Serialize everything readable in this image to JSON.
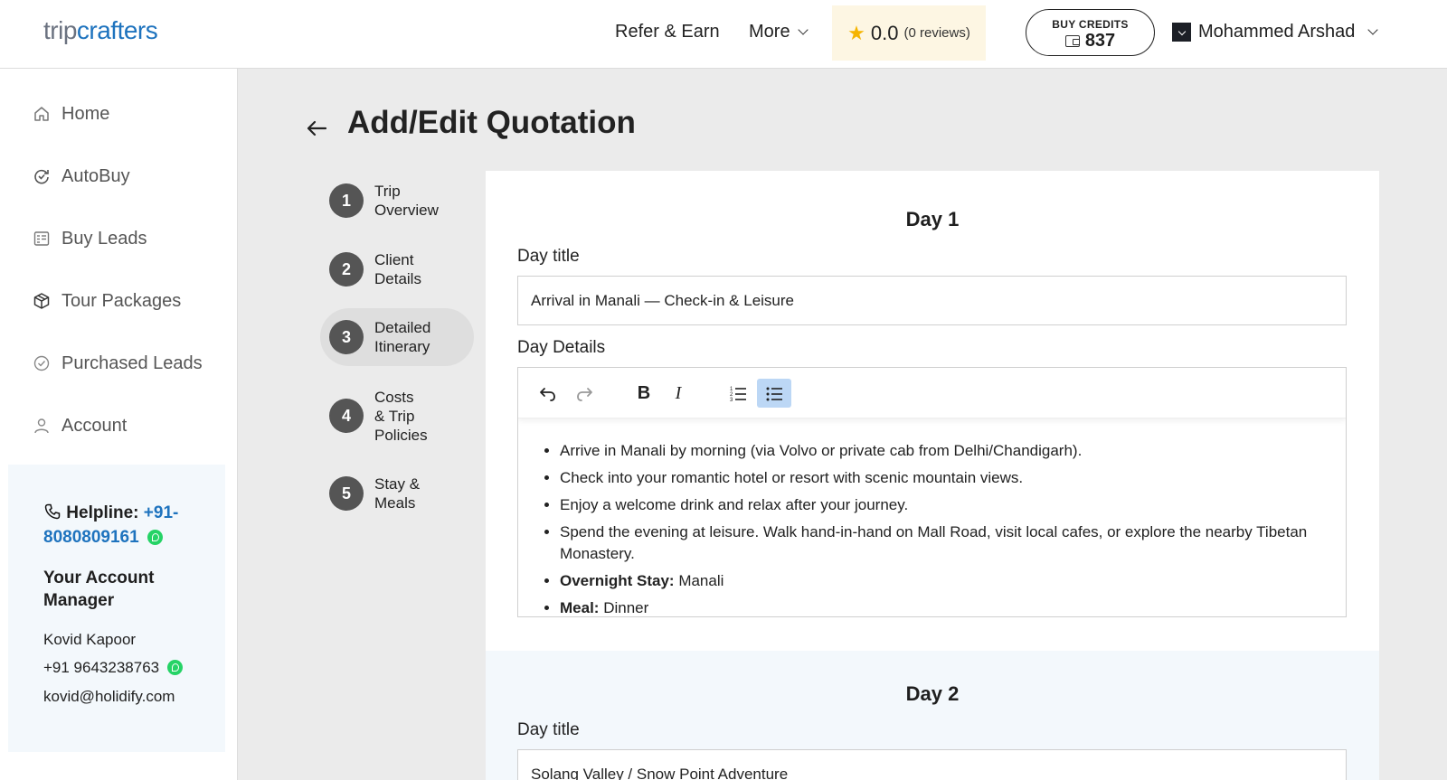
{
  "header": {
    "logo_part1": "trip",
    "logo_part2": "crafters",
    "nav_refer": "Refer & Earn",
    "nav_more": "More",
    "rating_score": "0.0",
    "rating_reviews": "(0 reviews)",
    "credits_label": "BUY CREDITS",
    "credits_value": "837",
    "user_name": "Mohammed Arshad"
  },
  "sidebar": {
    "items": [
      {
        "label": "Home",
        "icon": "home-icon"
      },
      {
        "label": "AutoBuy",
        "icon": "autobuy-icon"
      },
      {
        "label": "Buy Leads",
        "icon": "leads-icon"
      },
      {
        "label": "Tour Packages",
        "icon": "package-icon"
      },
      {
        "label": "Purchased Leads",
        "icon": "check-circle-icon"
      },
      {
        "label": "Account",
        "icon": "user-icon"
      }
    ],
    "helpline_label": "Helpline:",
    "helpline_number_part1": "+91-",
    "helpline_number_part2": "8080809161",
    "account_manager_title": "Your Account Manager",
    "manager_name": "Kovid Kapoor",
    "manager_phone": "+91 9643238763",
    "manager_email": "kovid@holidify.com"
  },
  "page": {
    "title": "Add/Edit Quotation"
  },
  "steps": [
    {
      "number": "1",
      "line1": "Trip",
      "line2": "Overview",
      "line3": "",
      "active": false
    },
    {
      "number": "2",
      "line1": "Client",
      "line2": "Details",
      "line3": "",
      "active": false
    },
    {
      "number": "3",
      "line1": "Detailed",
      "line2": "Itinerary",
      "line3": "",
      "active": true
    },
    {
      "number": "4",
      "line1": "Costs",
      "line2": "& Trip",
      "line3": "Policies",
      "active": false
    },
    {
      "number": "5",
      "line1": "Stay &",
      "line2": "Meals",
      "line3": "",
      "active": false
    }
  ],
  "days": [
    {
      "heading": "Day 1",
      "title_label": "Day title",
      "title_value": "Arrival in Manali — Check-in & Leisure",
      "details_label": "Day Details",
      "bullets": [
        {
          "bold": "",
          "text": "Arrive in Manali by morning (via Volvo or private cab from Delhi/Chandigarh)."
        },
        {
          "bold": "",
          "text": "Check into your romantic hotel or resort with scenic mountain views."
        },
        {
          "bold": "",
          "text": "Enjoy a welcome drink and relax after your journey."
        },
        {
          "bold": "",
          "text": "Spend the evening at leisure. Walk hand-in-hand on Mall Road, visit local cafes, or explore the nearby Tibetan Monastery."
        },
        {
          "bold": "Overnight Stay:",
          "text": " Manali"
        },
        {
          "bold": "Meal:",
          "text": " Dinner"
        }
      ]
    },
    {
      "heading": "Day 2",
      "title_label": "Day title",
      "title_value": "Solang Valley / Snow Point Adventure"
    }
  ],
  "toolbar": {
    "undo": "undo-icon",
    "redo": "redo-icon",
    "bold": "B",
    "italic": "I",
    "ordered_list": "ordered-list-icon",
    "bullet_list": "bullet-list-icon"
  },
  "colors": {
    "brand_blue": "#1e73be",
    "step_circle": "#555555",
    "active_toolbar": "#bcd7f5",
    "rating_bg": "#fdf6e3",
    "whatsapp": "#25d366"
  }
}
